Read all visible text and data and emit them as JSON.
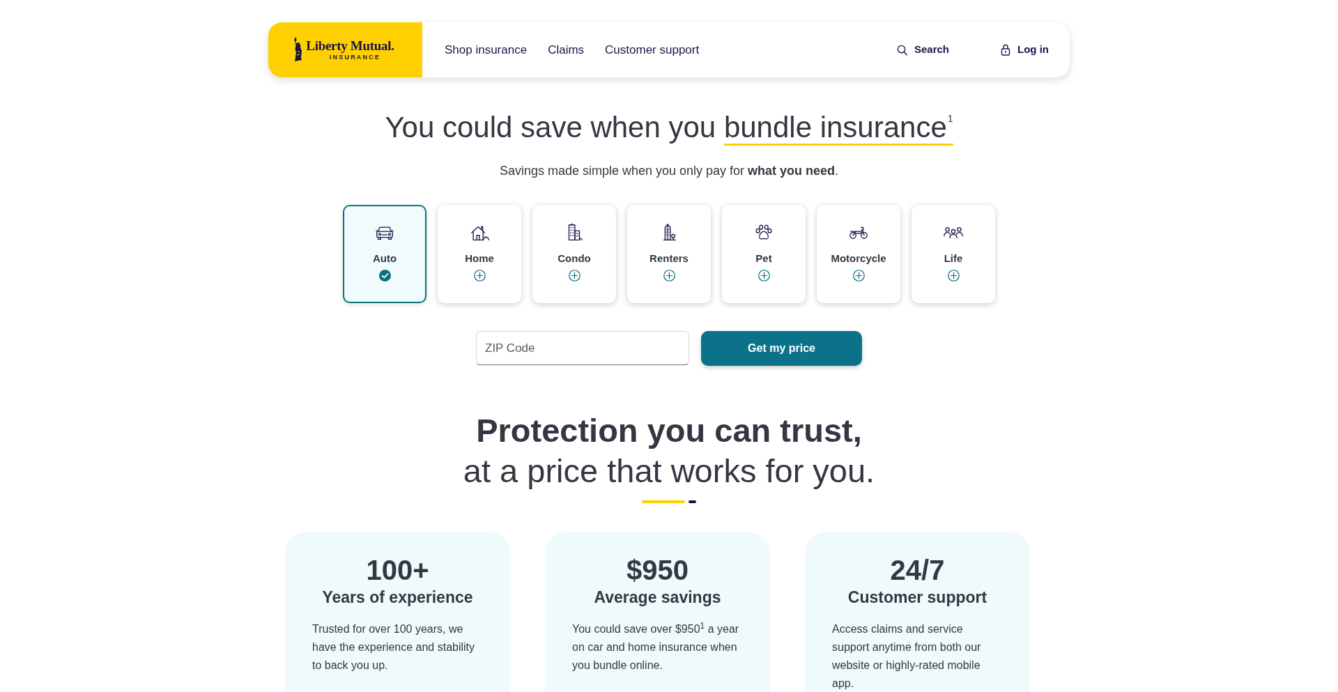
{
  "header": {
    "logo": {
      "wordmark": "Liberty Mutual.",
      "tagline": "INSURANCE"
    },
    "nav": [
      {
        "label": "Shop insurance"
      },
      {
        "label": "Claims"
      },
      {
        "label": "Customer support"
      }
    ],
    "actions": [
      {
        "kind": "search",
        "label": "Search"
      },
      {
        "kind": "login",
        "label": "Log in"
      }
    ]
  },
  "hero": {
    "headline_lead": "You could save when you",
    "headline_highlight": "bundle insurance",
    "headline_footnote": "1",
    "subtitle": "Savings made simple when you only pay for **what you need**."
  },
  "products": [
    {
      "kind": "auto",
      "label": "Auto",
      "selected": true
    },
    {
      "kind": "home",
      "label": "Home",
      "selected": false
    },
    {
      "kind": "condo",
      "label": "Condo",
      "selected": false
    },
    {
      "kind": "renters",
      "label": "Renters",
      "selected": false
    },
    {
      "kind": "pet",
      "label": "Pet",
      "selected": false
    },
    {
      "kind": "motorcycle",
      "label": "Motorcycle",
      "selected": false
    },
    {
      "kind": "life",
      "label": "Life",
      "selected": false
    }
  ],
  "quote_form": {
    "zip_field": {
      "placeholder": "ZIP Code"
    },
    "submit_button": "Get my price"
  },
  "trust_section": {
    "title": "Protection you can trust,",
    "subtitle": "at a price that works for you.",
    "stats": [
      {
        "value": "100+",
        "title": "Years of experience",
        "text": "Trusted for over 100 years, we have the experience and stability to back you up."
      },
      {
        "value": "$950",
        "title": "Average savings",
        "text": "You could save over $950$^{1}$ a year on car and home insurance when you bundle online."
      },
      {
        "value": "24/7",
        "title": "Customer support",
        "text": "Access claims and service support anytime from both our website or highly-rated mobile app."
      }
    ]
  }
}
